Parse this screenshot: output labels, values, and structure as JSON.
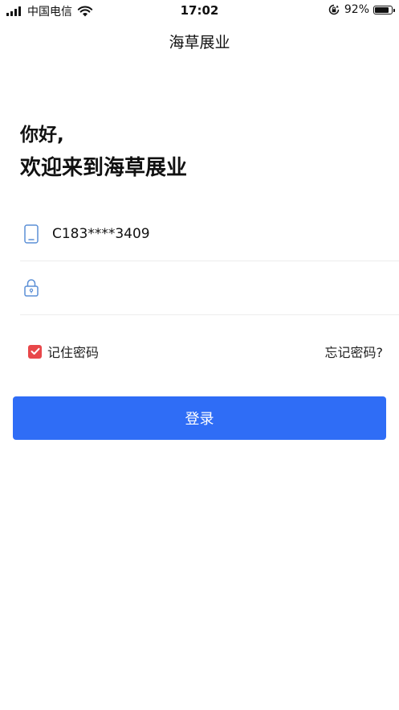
{
  "status_bar": {
    "carrier": "中国电信",
    "time": "17:02",
    "battery_percent": "92%",
    "battery_level": 0.92,
    "icons": [
      "signal-icon",
      "wifi-icon",
      "orientation-lock-icon",
      "battery-icon"
    ]
  },
  "nav": {
    "title": "海草展业"
  },
  "greeting": {
    "line1": "你好,",
    "line2": "欢迎来到海草展业"
  },
  "form": {
    "phone_value": "C183****3409",
    "phone_icon": "phone-icon",
    "password_value": "",
    "password_icon": "lock-icon",
    "remember_label": "记住密码",
    "remember_checked": true,
    "forgot_label": "忘记密码?",
    "login_label": "登录"
  },
  "colors": {
    "primary": "#2f6df6",
    "checkbox": "#e8474a",
    "icon_blue": "#5b8fd6"
  }
}
